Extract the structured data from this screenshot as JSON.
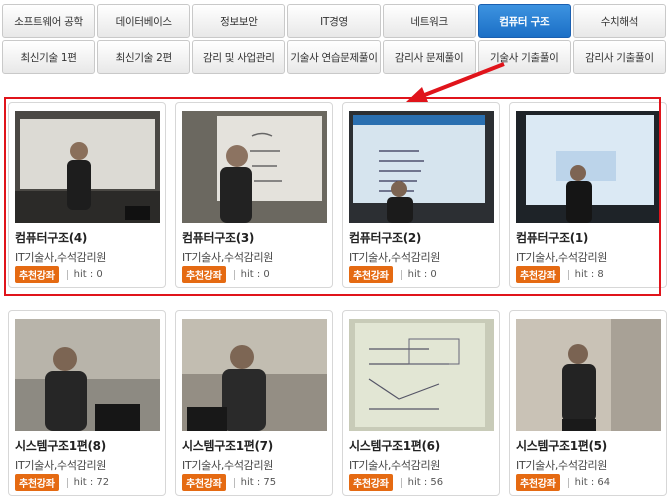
{
  "tabs": {
    "row1": [
      "소프트웨어 공학",
      "데이터베이스",
      "정보보안",
      "IT경영",
      "네트워크",
      "컴퓨터 구조",
      "수치해석"
    ],
    "row2": [
      "최신기술 1편",
      "최신기술 2편",
      "감리 및 사업관리",
      "기술사 연습문제풀이",
      "감리사 문제풀이",
      "기술사 기출풀이",
      "감리사 기출풀이"
    ],
    "active": "컴퓨터 구조"
  },
  "cards": [
    {
      "title": "컴퓨터구조(4)",
      "author": "IT기술사,수석감리원",
      "badge": "추천강좌",
      "hit_label": "hit : 0"
    },
    {
      "title": "컴퓨터구조(3)",
      "author": "IT기술사,수석감리원",
      "badge": "추천강좌",
      "hit_label": "hit : 0"
    },
    {
      "title": "컴퓨터구조(2)",
      "author": "IT기술사,수석감리원",
      "badge": "추천강좌",
      "hit_label": "hit : 0"
    },
    {
      "title": "컴퓨터구조(1)",
      "author": "IT기술사,수석감리원",
      "badge": "추천강좌",
      "hit_label": "hit : 8"
    },
    {
      "title": "시스템구조1편(8)",
      "author": "IT기술사,수석감리원",
      "badge": "추천강좌",
      "hit_label": "hit : 72"
    },
    {
      "title": "시스템구조1편(7)",
      "author": "IT기술사,수석감리원",
      "badge": "추천강좌",
      "hit_label": "hit : 75"
    },
    {
      "title": "시스템구조1편(6)",
      "author": "IT기술사,수석감리원",
      "badge": "추천강좌",
      "hit_label": "hit : 56"
    },
    {
      "title": "시스템구조1편(5)",
      "author": "IT기술사,수석감리원",
      "badge": "추천강좌",
      "hit_label": "hit : 64"
    }
  ],
  "colors": {
    "active_tab": "#1b6fc6",
    "highlight": "#e0141b",
    "badge": "#e56a12"
  }
}
